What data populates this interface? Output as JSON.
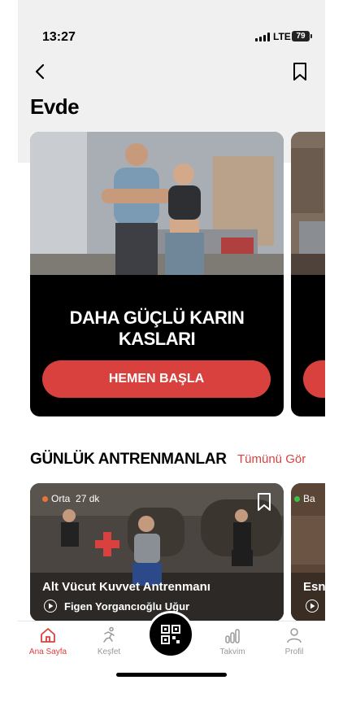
{
  "status": {
    "time": "13:27",
    "network": "LTE",
    "battery": "79"
  },
  "header": {
    "title": "Evde"
  },
  "featured": {
    "title": "DAHA GÜÇLÜ KARIN KASLARI",
    "button": "HEMEN BAŞLA"
  },
  "section": {
    "title": "GÜNLÜK ANTRENMANLAR",
    "see_all": "Tümünü Gör"
  },
  "workouts": [
    {
      "level": "Orta",
      "duration": "27 dk",
      "title": "Alt Vücut Kuvvet Antrenmanı",
      "author": "Figen Yorgancıoğlu Uğur",
      "dot_color": "#e8743b"
    },
    {
      "level": "Ba",
      "title": "Esn",
      "dot_color": "#38c24a"
    }
  ],
  "tabs": [
    {
      "label": "Ana Sayfa",
      "icon": "home-icon"
    },
    {
      "label": "Keşfet",
      "icon": "running-icon"
    },
    {
      "label": "",
      "icon": "qr-code-icon"
    },
    {
      "label": "Takvim",
      "icon": "bar-chart-icon"
    },
    {
      "label": "Profil",
      "icon": "user-icon"
    }
  ],
  "colors": {
    "accent": "#d9413f",
    "card_bg": "#000000"
  }
}
